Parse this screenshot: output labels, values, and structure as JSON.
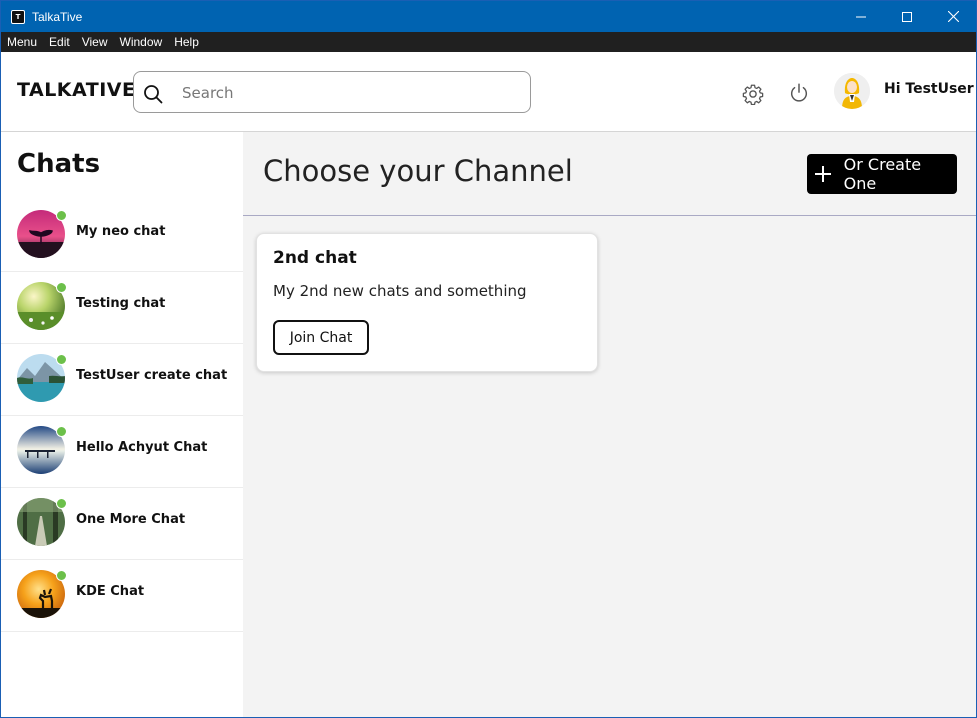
{
  "window": {
    "title": "TalkaTive",
    "app_icon_glyph": "T",
    "controls": [
      "minimize-icon",
      "maximize-icon",
      "close-icon"
    ]
  },
  "menubar": {
    "items": [
      "Menu",
      "Edit",
      "View",
      "Window",
      "Help"
    ]
  },
  "header": {
    "logo": "TALKATIVE",
    "search": {
      "placeholder": "Search",
      "value": ""
    },
    "greeting": "Hi TestUser",
    "icons": [
      "search-icon",
      "gear-icon",
      "power-icon",
      "user-avatar"
    ]
  },
  "sidebar": {
    "title": "Chats",
    "chats": [
      {
        "name": "My neo chat",
        "online": true,
        "avatar": "magenta-tree-landscape"
      },
      {
        "name": "Testing chat",
        "online": true,
        "avatar": "sunlit-green-meadow"
      },
      {
        "name": "TestUser create chat",
        "online": true,
        "avatar": "mountain-lake"
      },
      {
        "name": "Hello Achyut Chat",
        "online": true,
        "avatar": "blue-sunset-pier"
      },
      {
        "name": "One More Chat",
        "online": true,
        "avatar": "forest-path"
      },
      {
        "name": "KDE Chat",
        "online": true,
        "avatar": "deer-sunset-silhouette"
      }
    ]
  },
  "main": {
    "title": "Choose your Channel",
    "create_button": "Or Create One",
    "cards": [
      {
        "title": "2nd chat",
        "description": "My 2nd new chats and something",
        "button": "Join Chat"
      }
    ]
  },
  "colors": {
    "titlebar": "#0063b1",
    "menubar": "#202020",
    "online": "#6cc04a",
    "main_bg": "#f3f3f3",
    "create_button": "#000000"
  }
}
